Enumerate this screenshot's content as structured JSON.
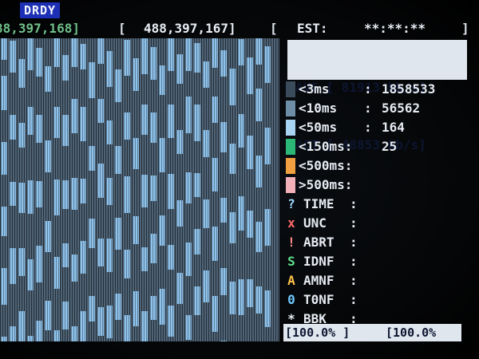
{
  "status": {
    "flag": "DRDY"
  },
  "lba": {
    "start": "88,397,168]",
    "open_bracket": "[",
    "end": "488,397,167]",
    "sep": "[",
    "est_label": "EST:",
    "est_value": "**:**:**",
    "close_bracket": "]"
  },
  "speed": {
    "avg": "AVG [ 81913 kb/s]",
    "act": "ACT [ 48853 kb/s]"
  },
  "timing": [
    {
      "label": "<3ms",
      "value": "1858533",
      "color": "#3a4c5c"
    },
    {
      "label": "<10ms",
      "value": "56562",
      "color": "#6e8ea8"
    },
    {
      "label": "<50ms",
      "value": "164",
      "color": "#a9d3f2"
    },
    {
      "label": "<150ms:",
      "value": "25",
      "color": "#2bb876"
    },
    {
      "label": "<500ms:",
      "value": "",
      "color": "#f0a040"
    },
    {
      "label": ">500ms:",
      "value": "",
      "color": "#f2b0b8"
    }
  ],
  "errors": [
    {
      "icon": "?",
      "label": "TIME",
      "icon_color": "#9fd8ff",
      "icon_name": "question-icon"
    },
    {
      "icon": "x",
      "label": "UNC",
      "icon_color": "#ff6a6a",
      "icon_name": "cross-icon"
    },
    {
      "icon": "!",
      "label": "ABRT",
      "icon_color": "#ff8a8a",
      "icon_name": "exclamation-icon"
    },
    {
      "icon": "S",
      "label": "IDNF",
      "icon_color": "#5ee08a",
      "icon_name": "s-icon"
    },
    {
      "icon": "A",
      "label": "AMNF",
      "icon_color": "#ffc24a",
      "icon_name": "a-icon"
    },
    {
      "icon": "0",
      "label": "T0NF",
      "icon_color": "#6fc8ff",
      "icon_name": "zero-icon"
    },
    {
      "icon": "*",
      "label": "BBK",
      "icon_color": "#e6ebf2",
      "icon_name": "asterisk-icon"
    }
  ],
  "progress": {
    "left": "[100.0% ]",
    "right": "[100.0%",
    "fraction": 1.0
  }
}
